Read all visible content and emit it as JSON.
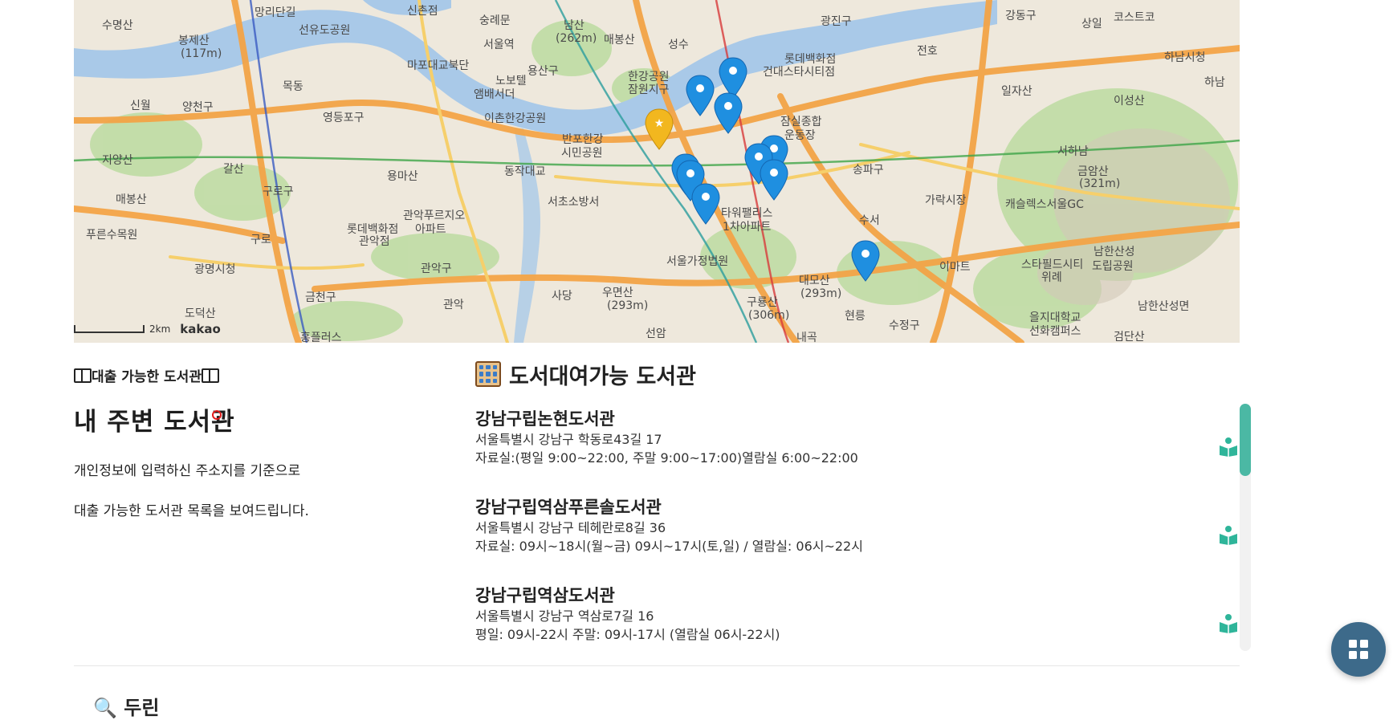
{
  "map": {
    "labels": [
      "망리단길",
      "신촌점",
      "수명산",
      "봉제산",
      "(117m)",
      "선유도공원",
      "숭례문",
      "서울역",
      "남산",
      "(262m)",
      "매봉산",
      "성수",
      "광진구",
      "강동구",
      "상일",
      "코스트코",
      "마포대교북단",
      "용산구",
      "한강공원",
      "잠원지구",
      "롯데백화점",
      "건대스타시티점",
      "전호",
      "하남시청",
      "하남",
      "목동",
      "노보텔",
      "앰배서더",
      "신월",
      "양천구",
      "영등포구",
      "이촌한강공원",
      "일자산",
      "이성산",
      "반포한강",
      "시민공원",
      "잠실종합",
      "운동장",
      "서하남",
      "금암산",
      "(321m)",
      "지양산",
      "갈산",
      "동작대교",
      "용마산",
      "송파구",
      "가락시장",
      "캐슬렉스서울GC",
      "매봉산",
      "구로구",
      "서초소방서",
      "타워팰리스",
      "1차아파트",
      "수서",
      "관악푸르지오",
      "아파트",
      "롯데백화점",
      "관악점",
      "구로",
      "푸른수목원",
      "이마트",
      "스타필드시티",
      "위례",
      "남한산성",
      "도립공원",
      "광명시청",
      "서울가정법원",
      "대모산",
      "(293m)",
      "관악구",
      "금천구",
      "우면산",
      "(293m)",
      "구룡산",
      "(306m)",
      "관악",
      "사당",
      "도덕산",
      "남한산성면",
      "현릉",
      "수정구",
      "을지대학교",
      "선화캠퍼스",
      "검단산",
      "내곡",
      "선암",
      "홍플러스"
    ],
    "scale_label": "2km",
    "attribution": "kakao"
  },
  "intro": {
    "tag": "대출 가능한 도서관",
    "title": "내 주변 도서관",
    "desc_line1": "개인정보에 입력하신 주소지를 기준으로",
    "desc_line2": "대출 가능한 도서관 목록을 보여드립니다."
  },
  "list": {
    "title": "도서대여가능 도서관",
    "items": [
      {
        "name": "강남구립논현도서관",
        "address": "서울특별시 강남구 학동로43길 17",
        "hours": "자료실:(평일 9:00~22:00, 주말 9:00~17:00)열람실 6:00~22:00"
      },
      {
        "name": "강남구립역삼푸른솔도서관",
        "address": "서울특별시 강남구 테헤란로8길 36",
        "hours": "자료실: 09시~18시(월~금) 09시~17시(토,일) / 열람실: 06시~22시"
      },
      {
        "name": "강남구립역삼도서관",
        "address": "서울특별시 강남구 역삼로7길 16",
        "hours": "평일: 09시-22시 주말: 09시-17시 (열람실 06시-22시)"
      }
    ],
    "action_icon": "book-reader-icon"
  },
  "next_section": {
    "heading": "🔍 두린"
  },
  "fab": {
    "icon": "grid-icon"
  },
  "colors": {
    "accent": "#4bb8a4",
    "pin": "#1f8fe0",
    "star_pin": "#f2b71f",
    "fab": "#3d6a8a"
  }
}
